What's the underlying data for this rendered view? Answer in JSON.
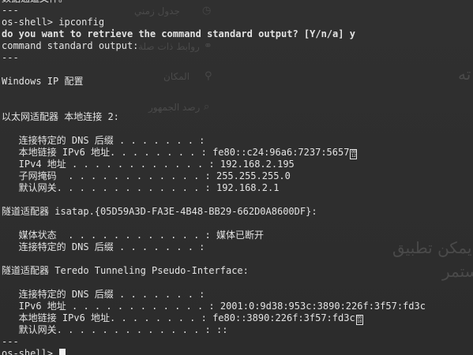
{
  "background": {
    "items": [
      {
        "icon": "clock-icon",
        "glyph": "◷",
        "text": "جدول زمني"
      },
      {
        "icon": "link-icon",
        "glyph": "⚭",
        "text": "روابط ذات صلة"
      },
      {
        "icon": "location-pin-icon",
        "glyph": "⚲",
        "text": "المكان"
      },
      {
        "icon": "search-icon",
        "glyph": "⌕",
        "text": "رصد الجمهور"
      }
    ],
    "right_heading": "ته",
    "promo_line1": "يمكن تطبيق",
    "promo_line2": "ستمر"
  },
  "terminal": {
    "lines": [
      {
        "text": "数据通道文件。"
      },
      {
        "text": "---"
      },
      {
        "text": "os-shell> ipconfig"
      },
      {
        "text": "do you want to retrieve the command standard output? [Y/n/a] y",
        "bold": true
      },
      {
        "text": "command standard output:"
      },
      {
        "text": "---"
      },
      {
        "text": ""
      },
      {
        "text": "Windows IP 配置"
      },
      {
        "text": ""
      },
      {
        "text": ""
      },
      {
        "text": "以太网适配器 本地连接 2:"
      },
      {
        "text": ""
      },
      {
        "text": "   连接特定的 DNS 后缀 . . . . . . . :"
      },
      {
        "text": "   本地链接 IPv6 地址. . . . . . . . : fe80::c24:96a6:7237:5657",
        "tofu": "0012"
      },
      {
        "text": "   IPv4 地址 . . . . . . . . . . . . : 192.168.2.195"
      },
      {
        "text": "   子网掩码  . . . . . . . . . . . . : 255.255.255.0"
      },
      {
        "text": "   默认网关. . . . . . . . . . . . . : 192.168.2.1"
      },
      {
        "text": ""
      },
      {
        "text": "隧道适配器 isatap.{05D59A3D-FA3E-4B48-BB29-662D0A8600DF}:"
      },
      {
        "text": ""
      },
      {
        "text": "   媒体状态  . . . . . . . . . . . . : 媒体已断开"
      },
      {
        "text": "   连接特定的 DNS 后缀 . . . . . . . :"
      },
      {
        "text": ""
      },
      {
        "text": "隧道适配器 Teredo Tunneling Pseudo-Interface:"
      },
      {
        "text": ""
      },
      {
        "text": "   连接特定的 DNS 后缀 . . . . . . . :"
      },
      {
        "text": "   IPv6 地址 . . . . . . . . . . . . : 2001:0:9d38:953c:3890:226f:3f57:fd3c"
      },
      {
        "text": "   本地链接 IPv6 地址. . . . . . . . : fe80::3890:226f:3f57:fd3c",
        "tofu": "0018"
      },
      {
        "text": "   默认网关. . . . . . . . . . . . . : ::"
      },
      {
        "text": "---"
      },
      {
        "text": "os-shell> ",
        "cursor": true
      }
    ]
  }
}
